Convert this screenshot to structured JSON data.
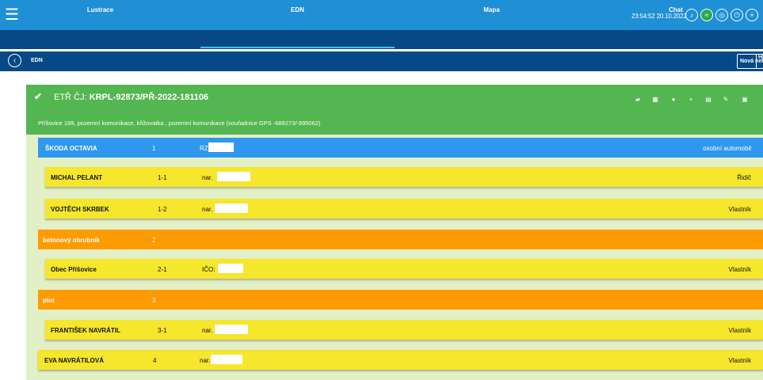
{
  "header": {
    "clock": "23:54:52 20.10.2022",
    "icons": [
      "bell-icon",
      "wifi-icon",
      "signal-icon",
      "power-icon",
      "plus-icon"
    ]
  },
  "tabs": [
    {
      "label": "Lustrace"
    },
    {
      "label": "EDN"
    },
    {
      "label": "Mapa"
    },
    {
      "label": "Chat"
    }
  ],
  "subheader": {
    "title": "EDN",
    "new_button": "Nová nehoda",
    "hi_button": "Hi"
  },
  "case": {
    "prefix": "ETŘ ČJ:",
    "number": "KRPL-92873/PŘ-2022-181106",
    "location": "Příšovice 189, pozemní komunikace, křižovatka , pozemní komunikace (souřadnice GPS -689273/-995062)",
    "action_icons": [
      "car-icon",
      "building-icon",
      "person-icon",
      "plus-icon",
      "printer-icon",
      "edit-icon",
      "window-icon"
    ]
  },
  "rows": [
    {
      "type": "vehicle",
      "name": "ŠKODA OCTAVIA",
      "num": "1",
      "label": "RZ:",
      "role": "osobní automobil"
    },
    {
      "type": "person",
      "name": "MICHAL PELANT",
      "num": "1-1",
      "label": "nar.",
      "role": "Řidič"
    },
    {
      "type": "person",
      "name": "VOJTĚCH SKRBEK",
      "num": "1-2",
      "label": "nar.",
      "role": "Vlastník"
    },
    {
      "type": "object",
      "name": "betonový obrubník",
      "num": "2",
      "label": "",
      "role": ""
    },
    {
      "type": "person",
      "name": "Obec Příšovice",
      "num": "2-1",
      "label": "IČO:",
      "role": "Vlastník"
    },
    {
      "type": "object",
      "name": "plot",
      "num": "3",
      "label": "",
      "role": ""
    },
    {
      "type": "person",
      "name": "FRANTIŠEK NAVRÁTIL",
      "num": "3-1",
      "label": "nar.",
      "role": "Vlastník"
    },
    {
      "type": "person-l",
      "name": "EVA NAVRÁTILOVÁ",
      "num": "4",
      "label": "nar.",
      "role": "Vlastník"
    }
  ],
  "colors": {
    "accent": "#1f8fd6",
    "nav": "#074987",
    "header_green": "#53b651",
    "vehicle": "#2f98ee",
    "person": "#f6e62c",
    "object": "#ff9b00"
  }
}
